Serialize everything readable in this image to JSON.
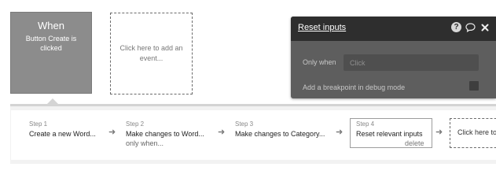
{
  "event": {
    "title": "When",
    "description": "Button Create is clicked"
  },
  "add_event_label": "Click here to add an event...",
  "popup": {
    "title": "Reset inputs",
    "icons": [
      "help-icon",
      "comment-icon",
      "close-icon"
    ],
    "only_when_label": "Only when",
    "only_when_placeholder": "Click",
    "breakpoint_label": "Add a breakpoint in debug mode"
  },
  "steps": [
    {
      "num": "Step 1",
      "name": "Create a new Word...",
      "sub": ""
    },
    {
      "num": "Step 2",
      "name": "Make changes to Word...",
      "sub": "only when..."
    },
    {
      "num": "Step 3",
      "name": "Make changes to Category...",
      "sub": ""
    },
    {
      "num": "Step 4",
      "name": "Reset relevant inputs",
      "sub": "delete"
    }
  ],
  "add_action_label": "Click here to"
}
